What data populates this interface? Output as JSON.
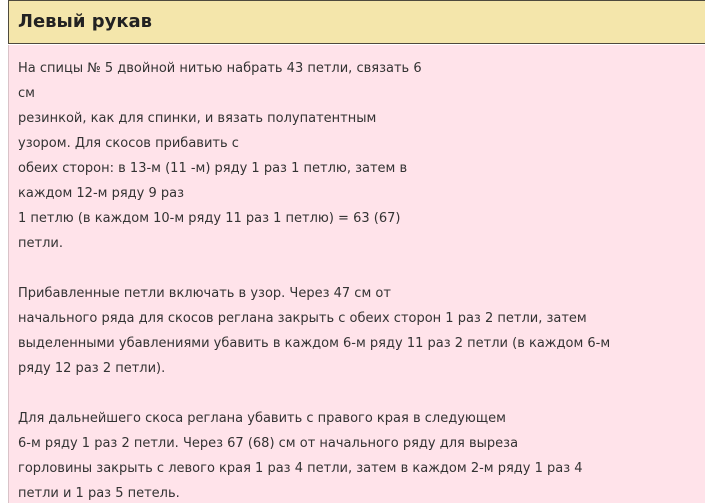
{
  "section": {
    "title": "Левый рукав"
  },
  "paragraphs": [
    {
      "lines": [
        "На спицы № 5 двойной нитью набрать 43 петли, связать 6",
        "см",
        "резинкой, как для спинки, и вязать полупатентным",
        "узором. Для скосов прибавить с",
        "обеих сторон: в 13-м (11 -м) ряду 1 раз 1 петлю, затем в",
        "каждом 12-м ряду 9 раз",
        "1 петлю (в каждом 10-м ряду 11 раз 1 петлю) = 63 (67)",
        "петли."
      ]
    },
    {
      "lines": [
        "Прибавленные петли включать в узор. Через 47 см от",
        "начального ряда для скосов реглана закрыть с обеих сторон 1 раз 2 петли, затем",
        "выделенными убавлениями убавить в каждом 6-м ряду 11 раз 2 петли (в каждом 6-м",
        "ряду 12 раз 2 петли)."
      ]
    },
    {
      "lines": [
        "Для дальнейшего скоса реглана убавить с правого края в следующем",
        "6-м ряду 1 раз 2 петли. Через 67 (68) см от начального ряду для выреза",
        "горловины закрыть с левого края 1 раз 4 петли, затем в каждом 2-м ряду 1 раз 4",
        "петли и 1 раз 5 петель."
      ]
    }
  ]
}
